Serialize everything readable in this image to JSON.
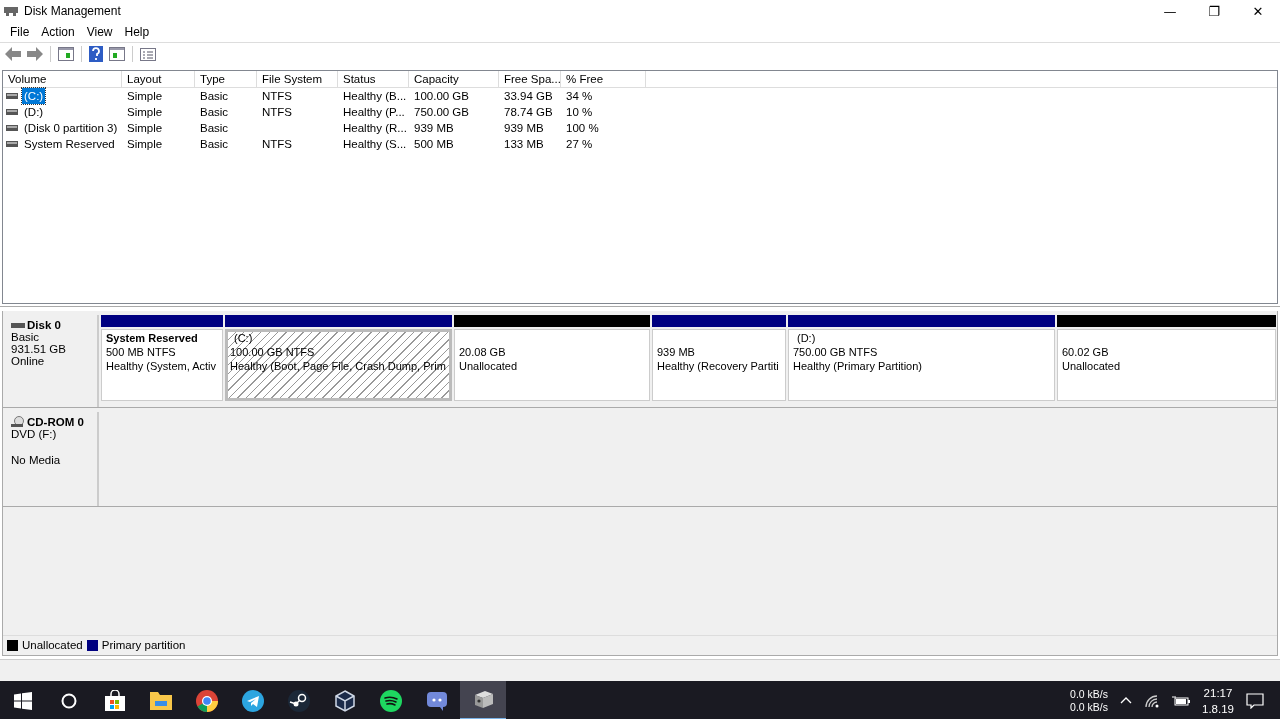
{
  "window": {
    "title": "Disk Management",
    "controls": [
      "—",
      "❐",
      "✕"
    ]
  },
  "menu": [
    "File",
    "Action",
    "View",
    "Help"
  ],
  "volume_table": {
    "columns": [
      "Volume",
      "Layout",
      "Type",
      "File System",
      "Status",
      "Capacity",
      "Free Spa...",
      "% Free"
    ],
    "rows": [
      {
        "cells": [
          "(C:)",
          "Simple",
          "Basic",
          "NTFS",
          "Healthy (B...",
          "100.00 GB",
          "33.94 GB",
          "34 %"
        ],
        "selected": true
      },
      {
        "cells": [
          "(D:)",
          "Simple",
          "Basic",
          "NTFS",
          "Healthy (P...",
          "750.00 GB",
          "78.74 GB",
          "10 %"
        ],
        "selected": false
      },
      {
        "cells": [
          "(Disk 0 partition 3)",
          "Simple",
          "Basic",
          "",
          "Healthy (R...",
          "939 MB",
          "939 MB",
          "100 %"
        ],
        "selected": false
      },
      {
        "cells": [
          "System Reserved",
          "Simple",
          "Basic",
          "NTFS",
          "Healthy (S...",
          "500 MB",
          "133 MB",
          "27 %"
        ],
        "selected": false
      }
    ]
  },
  "disks": [
    {
      "kind": "disk",
      "name": "Disk 0",
      "lines": [
        "Basic",
        "931.51 GB",
        "Online"
      ],
      "partitions": [
        {
          "kind": "primary",
          "name": "System Reserved",
          "name_bold": true,
          "size": "500 MB NTFS",
          "status": "Healthy (System, Activ",
          "selected": false
        },
        {
          "kind": "primary",
          "name": "(C:)",
          "name_bold": false,
          "size": "100.00 GB NTFS",
          "status": "Healthy (Boot, Page File, Crash Dump, Prim",
          "selected": true
        },
        {
          "kind": "unallocated",
          "size": "20.08 GB",
          "status": "Unallocated",
          "selected": false
        },
        {
          "kind": "primary",
          "size": "939 MB",
          "status": "Healthy (Recovery Partiti",
          "selected": false
        },
        {
          "kind": "primary",
          "name": "(D:)",
          "name_bold": false,
          "size": "750.00 GB NTFS",
          "status": "Healthy (Primary Partition)",
          "selected": false
        },
        {
          "kind": "unallocated",
          "size": "60.02 GB",
          "status": "Unallocated",
          "selected": false
        }
      ]
    },
    {
      "kind": "cdrom",
      "name": "CD-ROM 0",
      "lines": [
        "DVD (F:)"
      ],
      "status": "No Media"
    }
  ],
  "legend": [
    {
      "label": "Unallocated",
      "color": "#000000"
    },
    {
      "label": "Primary partition",
      "color": "#000080"
    }
  ],
  "taskbar": {
    "apps": [
      {
        "kind": "start",
        "selected": false
      },
      {
        "kind": "search",
        "selected": false
      },
      {
        "kind": "store",
        "selected": false
      },
      {
        "kind": "folder",
        "selected": false
      },
      {
        "kind": "browser",
        "selected": false
      },
      {
        "kind": "telegram",
        "selected": false
      },
      {
        "kind": "steam",
        "selected": false
      },
      {
        "kind": "cube",
        "selected": false
      },
      {
        "kind": "spotify",
        "selected": false
      },
      {
        "kind": "discord",
        "selected": false
      },
      {
        "kind": "disk",
        "selected": true
      }
    ],
    "net_speed": [
      "0.0 kB/s",
      "0.0 kB/s"
    ],
    "time": "21:17",
    "date": "1.8.19"
  }
}
